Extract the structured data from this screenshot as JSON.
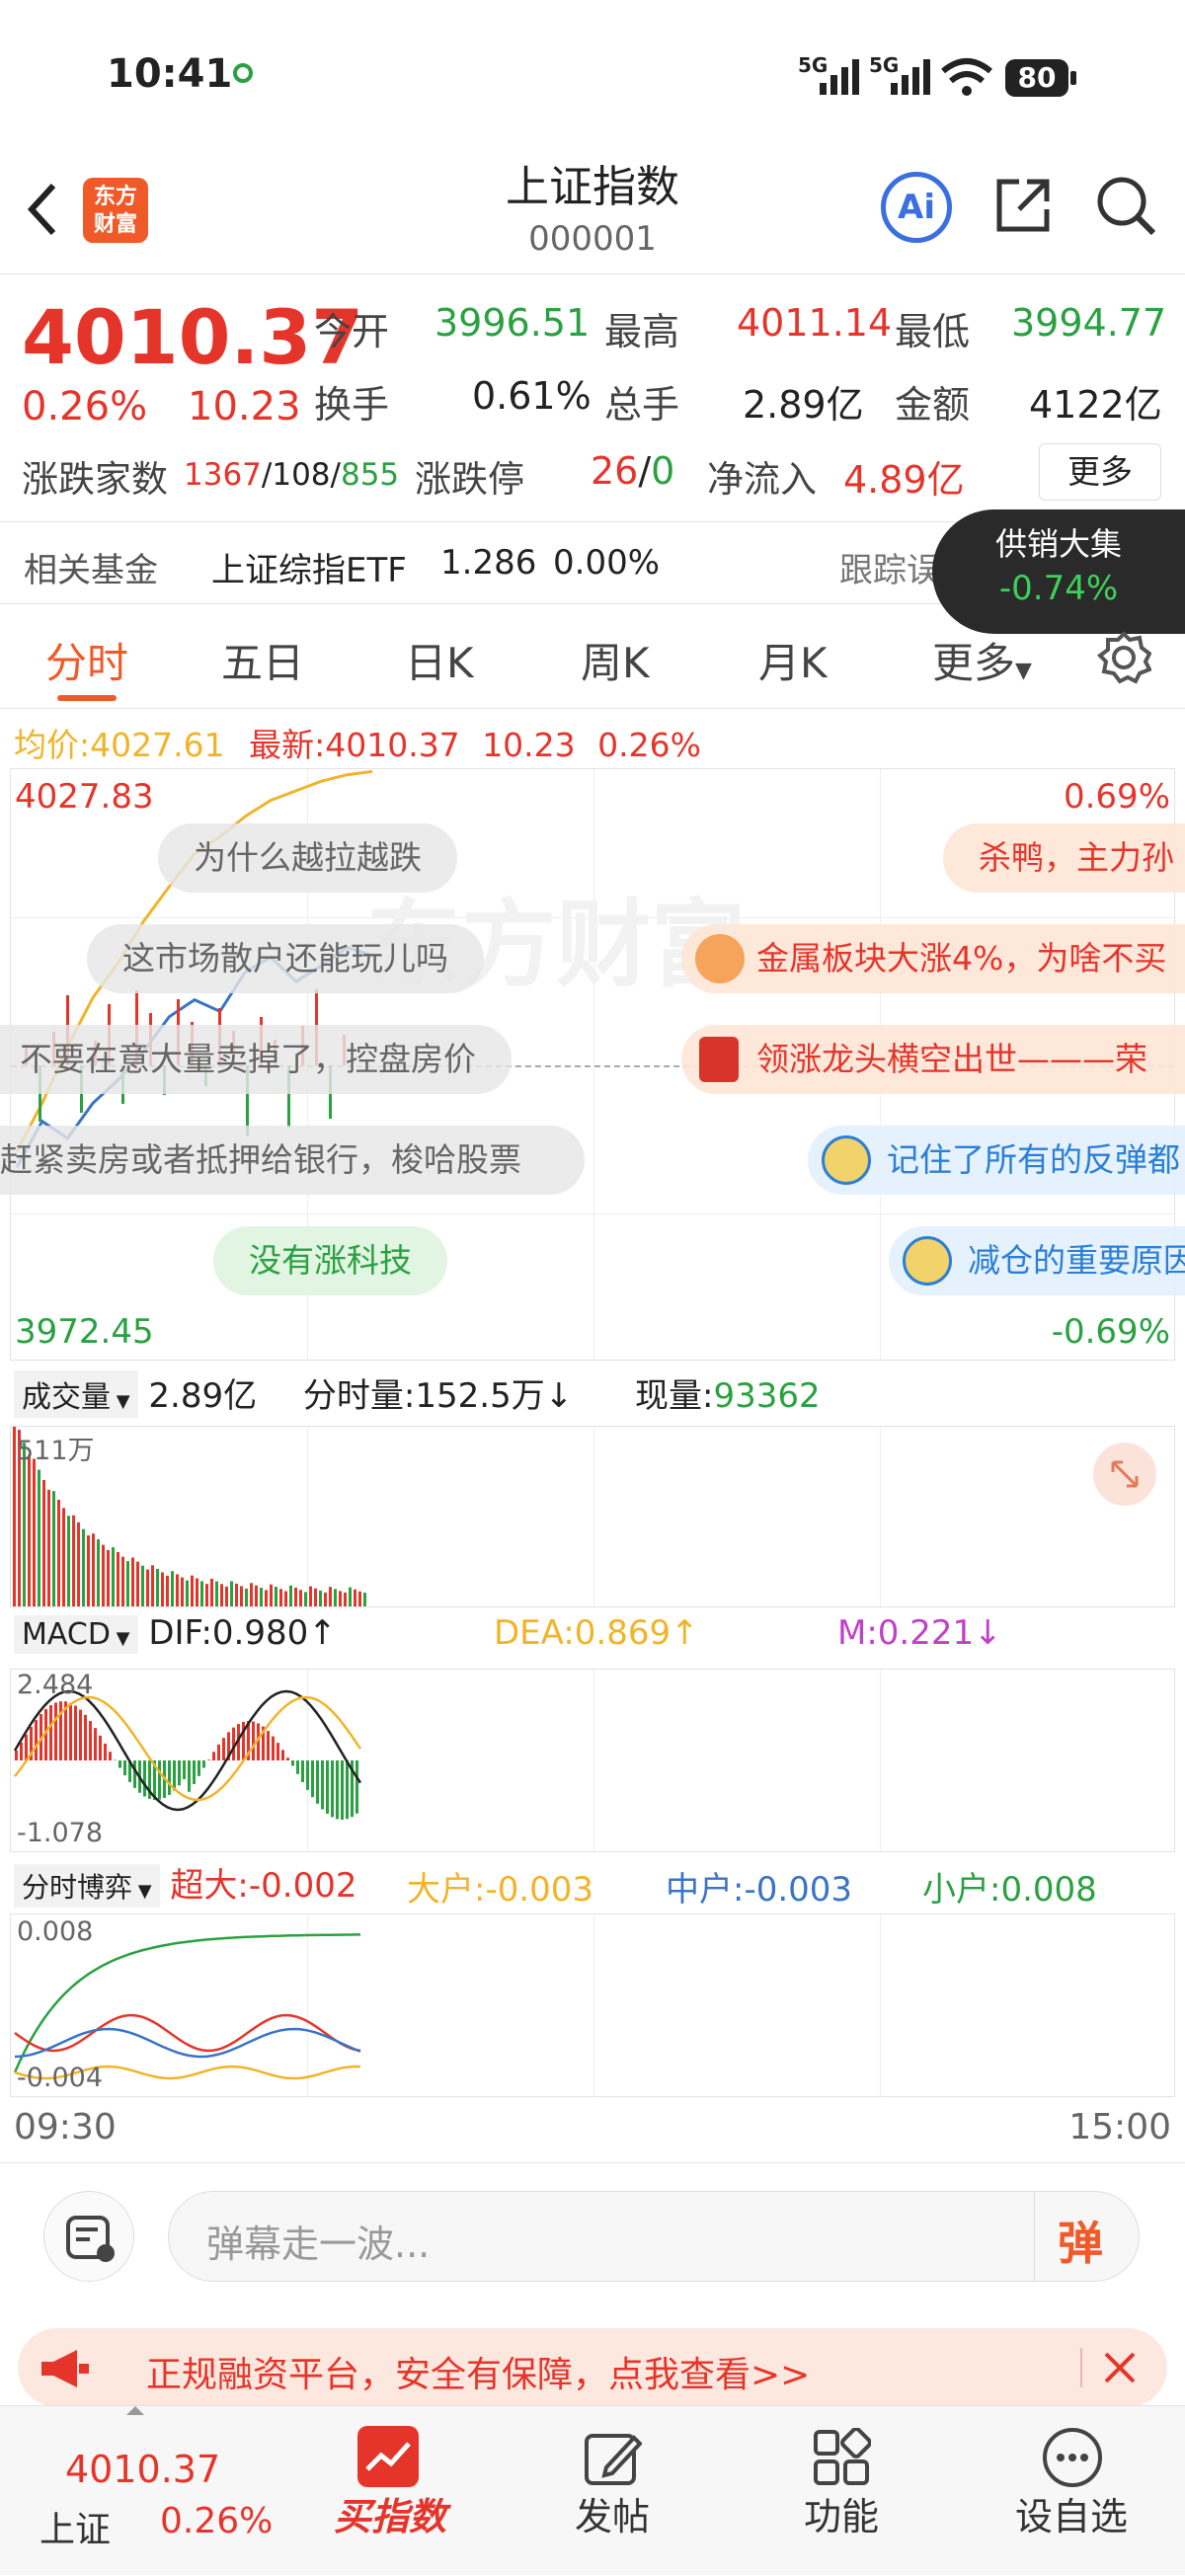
{
  "status_bar": {
    "time": "10:41",
    "signal1": "5G",
    "signal2": "5G",
    "battery": "80"
  },
  "header": {
    "title": "上证指数",
    "code": "000001",
    "logo_text_top": "东方",
    "logo_text_bottom": "财富",
    "ai_label": "Ai"
  },
  "quote": {
    "price": "4010.37",
    "change_pct": "0.26%",
    "change": "10.23",
    "open_label": "今开",
    "open": "3996.51",
    "high_label": "最高",
    "high": "4011.14",
    "low_label": "最低",
    "low": "3994.77",
    "turnover_label": "换手",
    "turnover": "0.61%",
    "volume_label": "总手",
    "volume": "2.89亿",
    "amount_label": "金额",
    "amount": "4122亿",
    "breadth_label": "涨跌家数",
    "up_count": "1367",
    "flat_count": "108",
    "down_count": "855",
    "limit_label": "涨跌停",
    "limit_up": "26",
    "limit_down": "0",
    "inflow_label": "净流入",
    "inflow": "4.89亿",
    "more_label": "更多"
  },
  "fund": {
    "label": "相关基金",
    "name": "上证综指ETF",
    "price": "1.286",
    "pct": "0.00%",
    "tracking": "跟踪误差",
    "popup_title": "供销大集",
    "popup_pct": "-0.74%"
  },
  "tabs": [
    "分时",
    "五日",
    "日K",
    "周K",
    "月K",
    "更多"
  ],
  "price_chart": {
    "avg_label": "均价:",
    "avg": "4027.61",
    "latest_label": "最新:",
    "latest": "4010.37",
    "latest_change": "10.23",
    "latest_pct": "0.26%",
    "top_price": "4027.83",
    "bottom_price": "3972.45",
    "top_pct": "0.69%",
    "bottom_pct": "-0.69%",
    "watermark": "东方财富"
  },
  "danmaku": [
    "为什么越拉越跌",
    "杀鸭，主力孙",
    "这市场散户还能玩儿吗",
    "金属板块大涨4%，为啥不买",
    "不要在意大量卖掉了，控盘房价",
    "领涨龙头横空出世———荣",
    "赶紧卖房或者抵押给银行，梭哈股票",
    "记住了所有的反弹都",
    "没有涨科技",
    "减仓的重要原因"
  ],
  "volume_panel": {
    "selector": "成交量",
    "total": "2.89亿",
    "bar_label": "分时量:",
    "bar_value": "152.5万",
    "bar_arrow": "↓",
    "now_label": "现量:",
    "now_value": "93362",
    "max_label": "511万"
  },
  "macd_panel": {
    "selector": "MACD",
    "dif": "DIF:0.980",
    "dif_arrow": "↑",
    "dea": "DEA:0.869",
    "dea_arrow": "↑",
    "m": "M:0.221",
    "m_arrow": "↓",
    "max": "2.484",
    "min": "-1.078"
  },
  "flow_panel": {
    "selector": "分时博弈",
    "super": "超大:-0.002",
    "big": "大户:-0.003",
    "mid": "中户:-0.003",
    "small": "小户:0.008",
    "max": "0.008",
    "min": "-0.004"
  },
  "time_axis": {
    "start": "09:30",
    "end": "15:00"
  },
  "composer": {
    "placeholder": "弹幕走一波...",
    "send_label": "弹"
  },
  "promo": {
    "text": "正规融资平台，安全有保障，点我查看>>"
  },
  "bottom_bar": {
    "index_price": "4010.37",
    "index_name": "上证",
    "index_pct": "0.26%",
    "items": [
      "买指数",
      "发帖",
      "功能",
      "设自选"
    ]
  },
  "colors": {
    "up": "#e5352b",
    "down": "#2aa140",
    "accent": "#f05a28",
    "avg_line": "#f0b429",
    "price_line": "#3a74c6"
  },
  "chart_data": {
    "type": "line",
    "x_range": [
      "09:30",
      "15:00"
    ],
    "ylim": [
      3972.45,
      4027.83
    ],
    "series": [
      {
        "name": "最新",
        "values": [
          3990.5,
          3994.8,
          3993.2,
          3996.5,
          3998.7,
          4001.4,
          4004.6,
          4006.2,
          4005.1,
          4008.8,
          4010.2,
          4007.9,
          4009.4,
          4011.1,
          4010.37
        ]
      },
      {
        "name": "均价",
        "values": [
          3992.0,
          3996.5,
          4001.8,
          4006.4,
          4009.7,
          4013.6,
          4016.8,
          4019.9,
          4021.5,
          4023.4,
          4024.9,
          4025.8,
          4026.7,
          4027.3,
          4027.61
        ]
      }
    ]
  }
}
